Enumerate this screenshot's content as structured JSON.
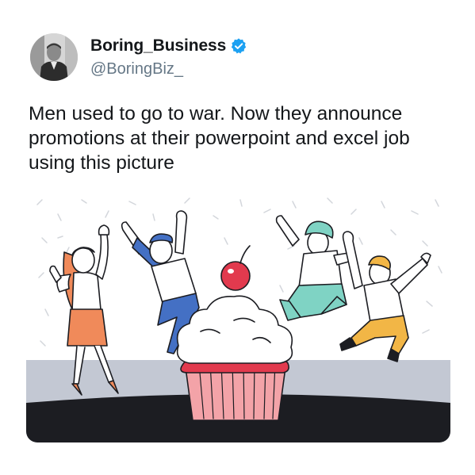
{
  "author": {
    "display_name": "Boring_Business",
    "handle": "@BoringBiz_",
    "verified": true,
    "avatar_icon": "vintage-businessman-photo"
  },
  "tweet": {
    "text": "Men used to go to war. Now they announce promotions at their powerpoint and excel job using this picture"
  },
  "media": {
    "type": "illustration",
    "subject": "celebration-cupcake-illustration",
    "colors": {
      "floor": "#c3c8d3",
      "floor_shadow": "#1c1d22",
      "cupcake_wrapper": "#f3a3a8",
      "cherry": "#e23a4e",
      "accent_orange": "#f08a5a",
      "accent_teal": "#7fd3c4",
      "accent_blue": "#4470c4",
      "accent_yellow": "#f2b646"
    }
  },
  "colors": {
    "text": "#14171a",
    "secondary_text": "#657786",
    "verified_blue": "#1da1f2"
  }
}
